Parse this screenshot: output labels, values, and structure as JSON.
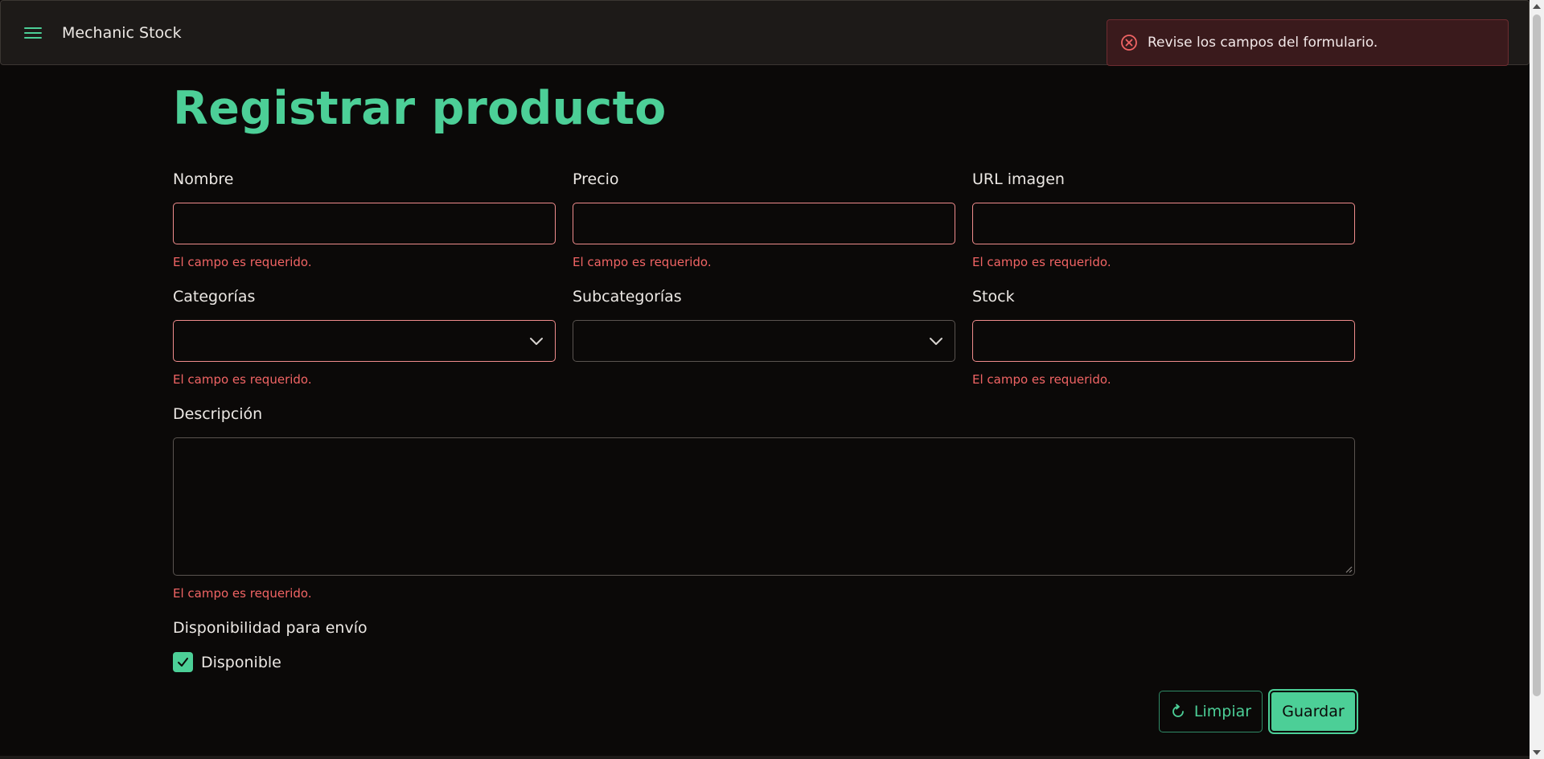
{
  "header": {
    "app_title": "Mechanic Stock",
    "menu_icon": "hamburger-menu-icon"
  },
  "toast": {
    "icon": "error-circle-x-icon",
    "message": "Revise los campos del formulario."
  },
  "colors": {
    "accent": "#4ccf97",
    "error": "#f06464",
    "error_border": "#f08c8c",
    "background": "#0b0908",
    "topbar": "#1d1a18",
    "toast_bg": "#3a1a1c"
  },
  "form": {
    "title": "Registrar producto",
    "fields": {
      "nombre": {
        "label": "Nombre",
        "value": "",
        "error": "El campo es requerido."
      },
      "precio": {
        "label": "Precio",
        "value": "",
        "error": "El campo es requerido."
      },
      "url_imagen": {
        "label": "URL imagen",
        "value": "",
        "error": "El campo es requerido."
      },
      "categorias": {
        "label": "Categorías",
        "selected": "",
        "error": "El campo es requerido."
      },
      "subcategorias": {
        "label": "Subcategorías",
        "selected": ""
      },
      "stock": {
        "label": "Stock",
        "value": "",
        "error": "El campo es requerido."
      },
      "descripcion": {
        "label": "Descripción",
        "value": "",
        "error": "El campo es requerido."
      }
    },
    "shipping": {
      "label": "Disponibilidad para envío",
      "checkbox_label": "Disponible",
      "checked": true
    },
    "buttons": {
      "clear_label": "Limpiar",
      "clear_icon": "refresh-icon",
      "save_label": "Guardar"
    }
  }
}
